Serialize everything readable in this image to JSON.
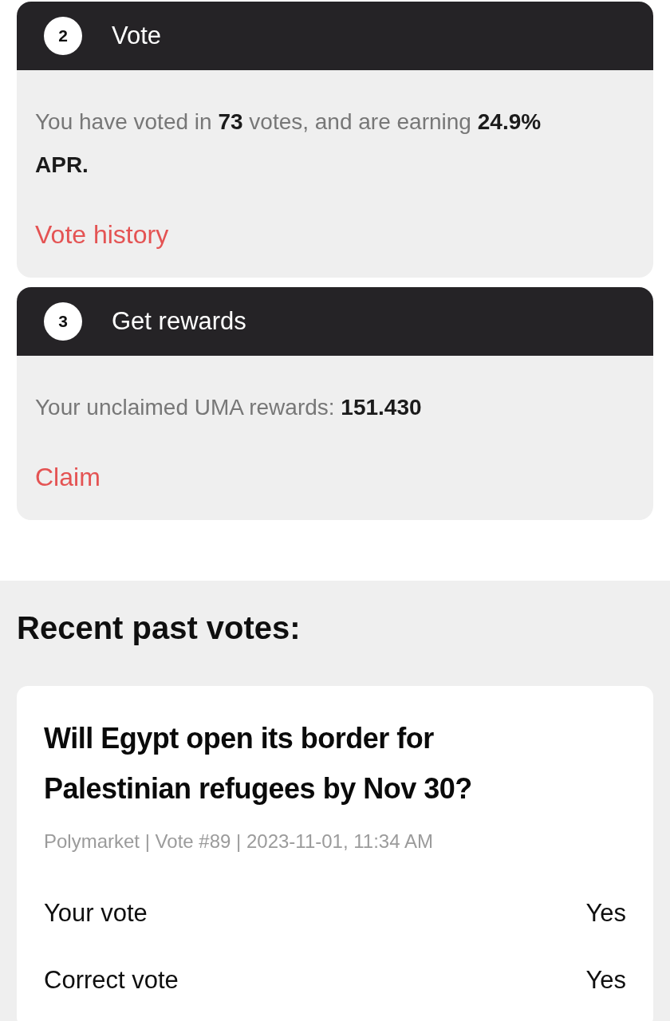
{
  "steps": [
    {
      "number": "2",
      "title": "Vote",
      "text": "You have voted in **73** votes, and are earning **24.9% APR.**",
      "link": "Vote history"
    },
    {
      "number": "3",
      "title": "Get rewards",
      "text": "Your unclaimed UMA rewards: **151.430**",
      "link": "Claim"
    }
  ],
  "recent_votes": {
    "heading": "Recent past votes:",
    "items": [
      {
        "question": "Will Egypt open its border for Palestinian refugees by Nov 30?",
        "meta": "Polymarket | Vote #89 | 2023-11-01, 11:34 AM",
        "rows": [
          {
            "label": "Your vote",
            "value": "Yes"
          },
          {
            "label": "Correct vote",
            "value": "Yes"
          }
        ]
      }
    ]
  }
}
